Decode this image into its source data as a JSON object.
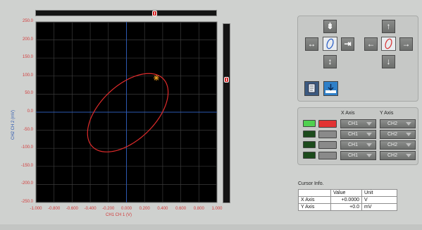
{
  "plot": {
    "y_ticks": [
      "250.0",
      "200.0",
      "150.0",
      "100.0",
      "50.0",
      "0.0",
      "-50.0",
      "-100.0",
      "-150.0",
      "-200.0",
      "-250.0"
    ],
    "x_ticks": [
      "-1.000",
      "-0.800",
      "-0.600",
      "-0.400",
      "-0.200",
      "0.000",
      "0.200",
      "0.400",
      "0.600",
      "0.800",
      "1.000"
    ],
    "x_axis_label": "CH1   CH 1      (V)",
    "y_axis_label": "CH2   CH 2               (mV)",
    "trace_color": "#e02b2b",
    "cursor_color": "#f0a020",
    "grid_color": "#3a3a3a",
    "axis_color": "#2d59b0"
  },
  "chart_data": {
    "type": "line",
    "title": "",
    "xlabel": "CH1   CH 1      (V)",
    "ylabel": "CH2   CH 2               (mV)",
    "xlim": [
      -1.0,
      1.0
    ],
    "ylim": [
      -250.0,
      250.0
    ],
    "grid": true,
    "series": [
      {
        "shape": "ellipse",
        "center": [
          0.0,
          0.0
        ],
        "x_extent": [
          -0.43,
          0.46
        ],
        "y_extent": [
          -110,
          107
        ],
        "color": "#e02b2b"
      }
    ],
    "cursor": {
      "x": 0.33,
      "y": 95
    }
  },
  "channels": {
    "x_axis_header": "X Axis",
    "y_axis_header": "Y Axis",
    "rows": [
      {
        "led": "#4fd14f",
        "color": "#e23333",
        "x": "CH1",
        "y": "CH2"
      },
      {
        "led": "#1c4b1c",
        "color": "#8a8a8a",
        "x": "CH1",
        "y": "CH2"
      },
      {
        "led": "#1c4b1c",
        "color": "#8a8a8a",
        "x": "CH1",
        "y": "CH2"
      },
      {
        "led": "#1c4b1c",
        "color": "#8a8a8a",
        "x": "CH1",
        "y": "CH2"
      }
    ]
  },
  "cursor_info": {
    "title": "Cursor Info.",
    "col_value": "Value",
    "col_unit": "Unit",
    "rows": [
      {
        "name": "X Axis",
        "value": "+0.0000",
        "unit": "V"
      },
      {
        "name": "Y Axis",
        "value": "+0.0",
        "unit": "mV"
      }
    ]
  },
  "controls": {
    "up_icon": "up-arrow-icon",
    "down_icon": "down-arrow-icon",
    "left_icon": "left-arrow-icon",
    "right_icon": "right-arrow-icon",
    "compress_v_icon": "compress-vertical-icon",
    "compress_h_icon": "compress-horizontal-icon",
    "expand_v_icon": "expand-vertical-icon",
    "expand_h_icon": "expand-horizontal-icon"
  }
}
